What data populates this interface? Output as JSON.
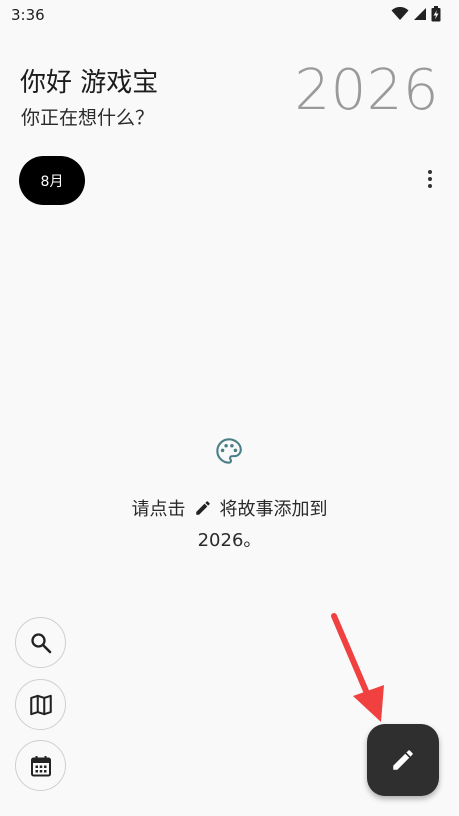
{
  "status_bar": {
    "time": "3:36"
  },
  "header": {
    "greeting": "你好 游戏宝",
    "subtitle": "你正在想什么？",
    "year": "2026"
  },
  "month_chip": {
    "label": "8月"
  },
  "empty_state": {
    "line1_before": "请点击",
    "line1_after": "将故事添加到",
    "line2": "2026。"
  },
  "icons": {
    "search": "search-icon",
    "map": "map-icon",
    "calendar": "calendar-icon",
    "edit": "pencil-icon",
    "palette": "palette-icon",
    "more": "more-vertical-icon"
  },
  "colors": {
    "background": "#f9f9f9",
    "chip_bg": "#000000",
    "fab_bg": "#2f2f2f",
    "palette_teal": "#4a7f86",
    "arrow_red": "#f04040"
  }
}
